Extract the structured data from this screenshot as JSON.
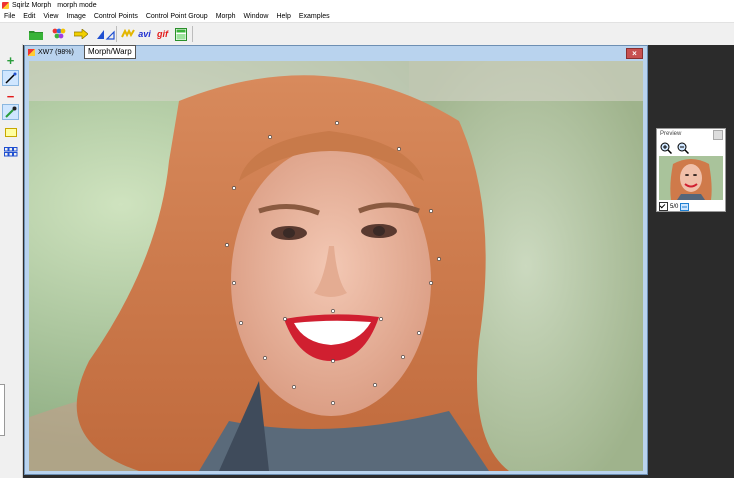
{
  "app": {
    "title": "Sqirlz Morph",
    "mode": "morph mode"
  },
  "menu": [
    "File",
    "Edit",
    "View",
    "Image",
    "Control Points",
    "Control Point Group",
    "Morph",
    "Window",
    "Help",
    "Examples"
  ],
  "toolbar": {
    "icons": [
      "open-folder-icon",
      "colors-icon",
      "arrow-right-icon",
      "morph-triangle-icon",
      "morph-sequence-icon",
      "avi-export-icon",
      "gif-export-icon",
      "frame-icon"
    ],
    "avi_label": "avi",
    "gif_label": "gif"
  },
  "tooltip": "Morph/Warp",
  "left_tools": {
    "add_symbol": "+",
    "remove_symbol": "−"
  },
  "child_window": {
    "title": "XW7  (98%)",
    "close": "×"
  },
  "preview": {
    "title": "Preview",
    "counter": "5/0"
  },
  "colors": {
    "accent": "#2a9d3c",
    "window_frame": "#b9d3ee",
    "workspace": "#2b2b2b",
    "close_button": "#c75050",
    "control_point": "#ffffff"
  }
}
